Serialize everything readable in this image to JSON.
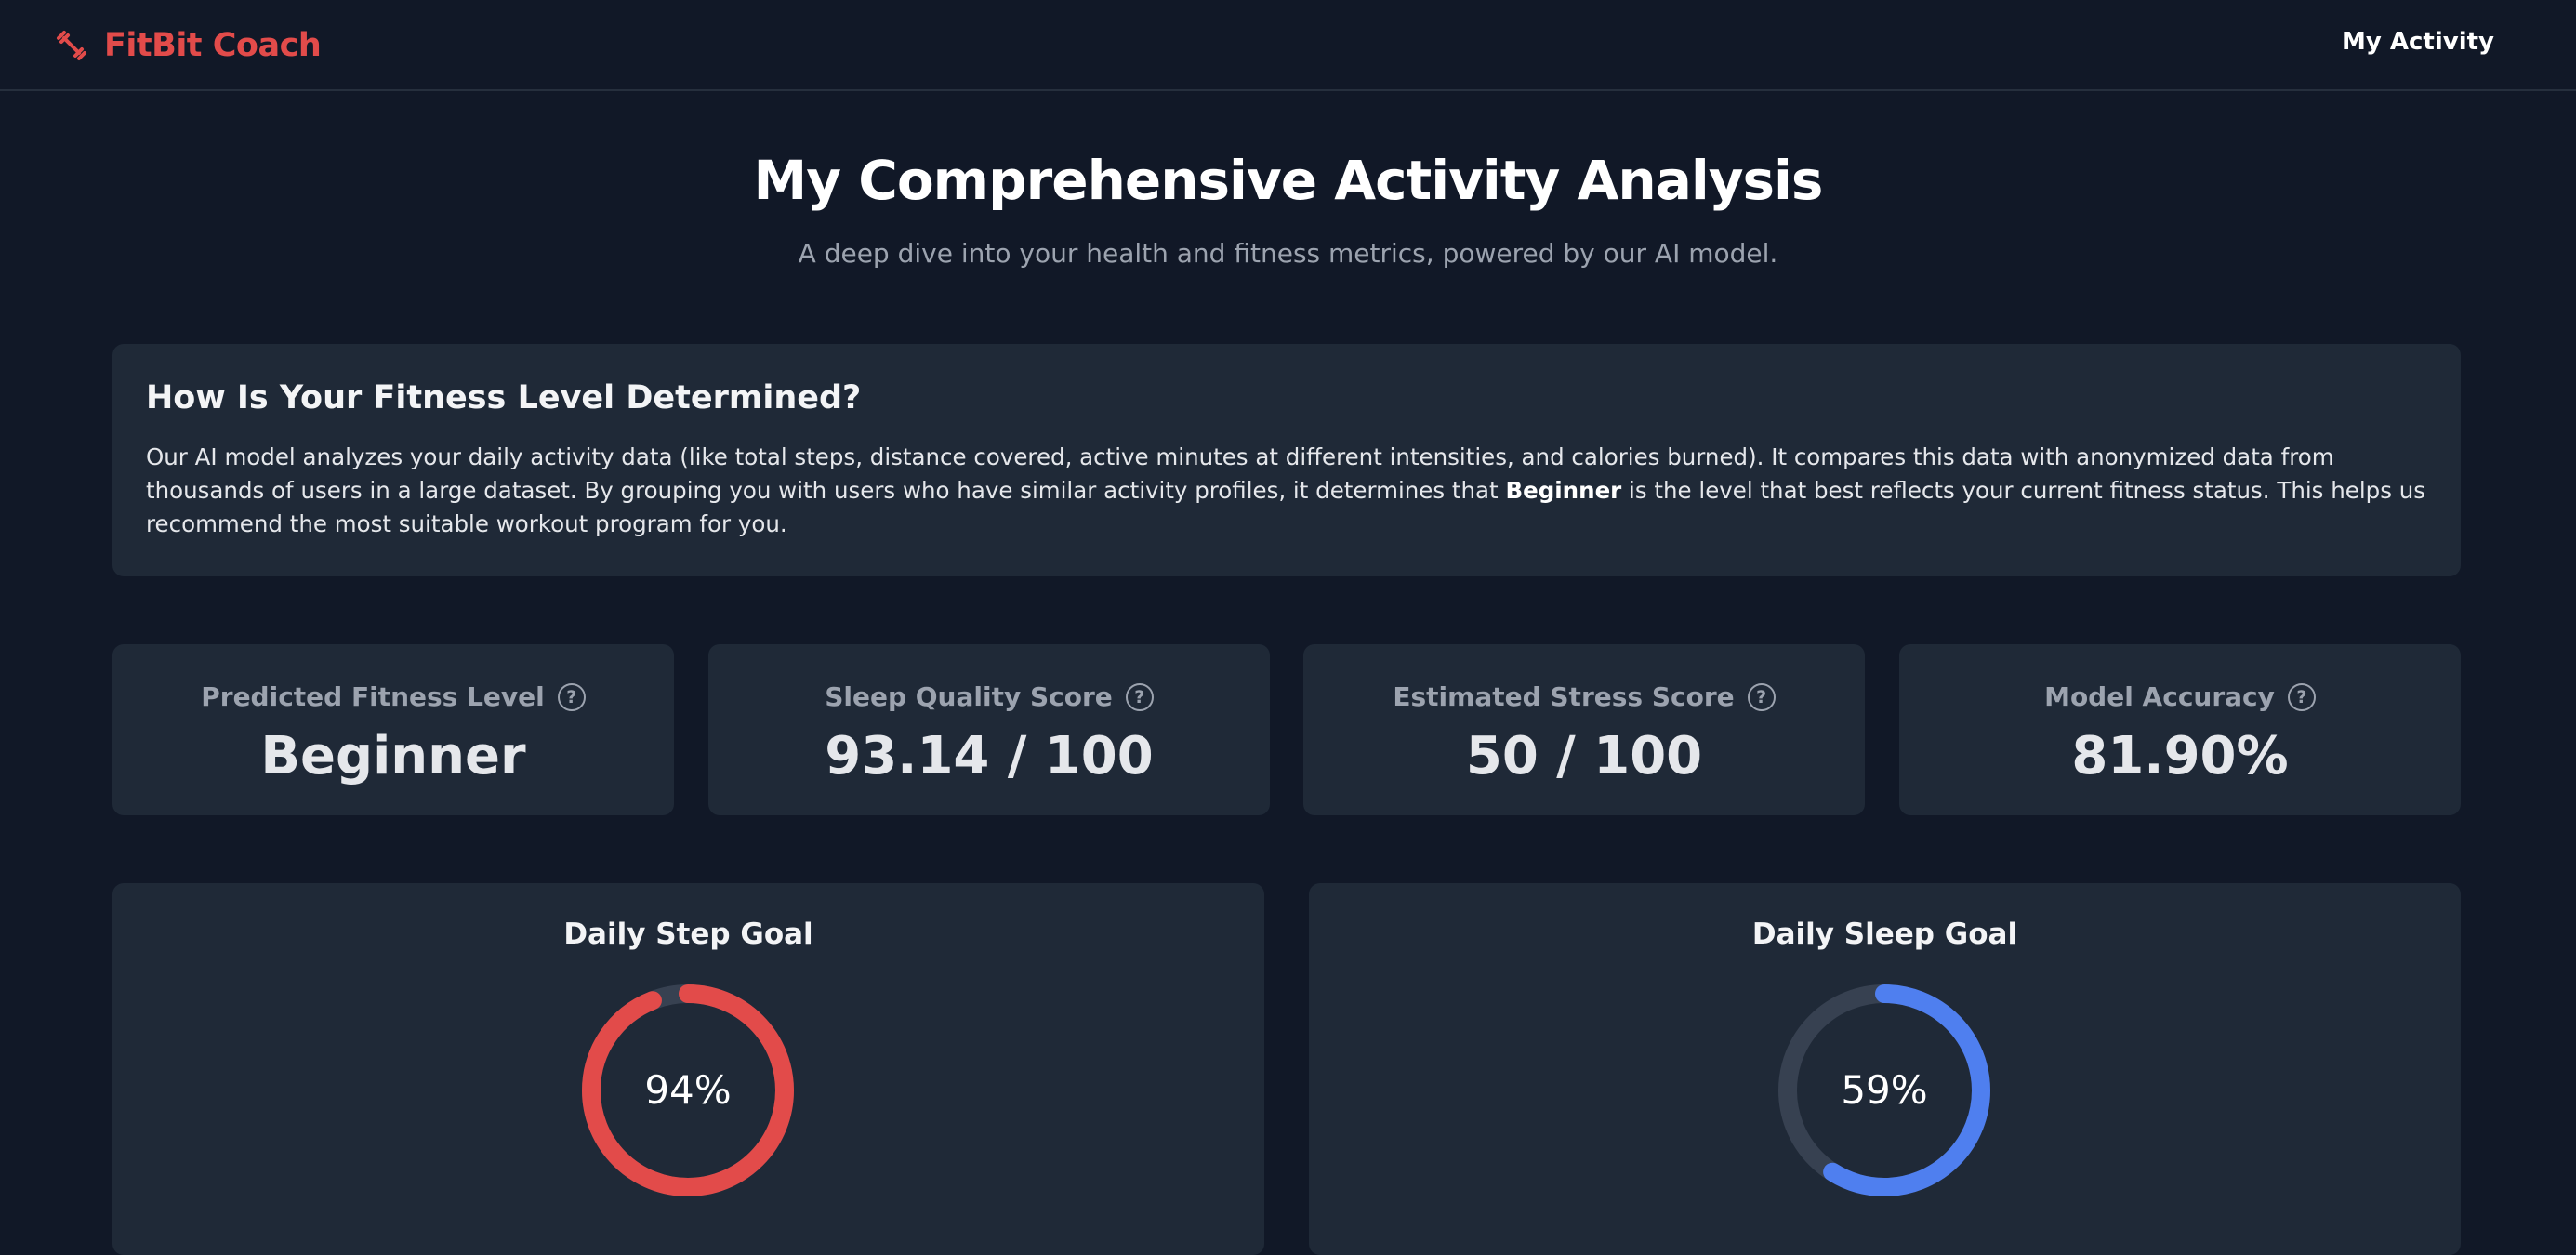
{
  "nav": {
    "brand_icon": "dumbbell-icon",
    "brand_name": "FitBit Coach",
    "link_my_activity": "My Activity"
  },
  "header": {
    "title": "My Comprehensive Activity Analysis",
    "subtitle": "A deep dive into your health and fitness metrics, powered by our AI model."
  },
  "info": {
    "title": "How Is Your Fitness Level Determined?",
    "text_before": "Our AI model analyzes your daily activity data (like total steps, distance covered, active minutes at different intensities, and calories burned). It compares this data with anonymized data from thousands of users in a large dataset. By grouping you with users who have similar activity profiles, it determines that ",
    "highlight": "Beginner",
    "text_after": " is the level that best reflects your current fitness status. This helps us recommend the most suitable workout program for you."
  },
  "stats": [
    {
      "label": "Predicted Fitness Level",
      "value": "Beginner",
      "help_icon": "?"
    },
    {
      "label": "Sleep Quality Score",
      "value": "93.14 / 100",
      "help_icon": "?"
    },
    {
      "label": "Estimated Stress Score",
      "value": "50 / 100",
      "help_icon": "?"
    },
    {
      "label": "Model Accuracy",
      "value": "81.90%",
      "help_icon": "?"
    }
  ],
  "goals": [
    {
      "title": "Daily Step Goal",
      "percent_label": "94%",
      "progress": 0.94,
      "color": "#e24b4a"
    },
    {
      "title": "Daily Sleep Goal",
      "percent_label": "59%",
      "progress": 0.59,
      "color": "#4f7fef"
    }
  ],
  "colors": {
    "background": "#111827",
    "card": "#1f2937",
    "accent_red": "#e24b4a",
    "accent_blue": "#4f7fef",
    "track": "#374151"
  }
}
